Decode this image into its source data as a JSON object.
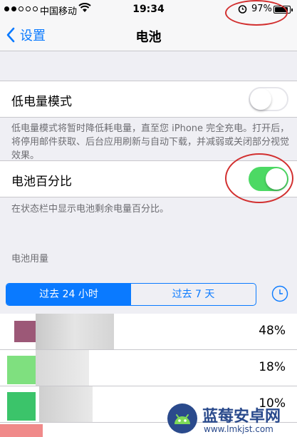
{
  "status_bar": {
    "carrier": "中国移动",
    "time": "19:34",
    "battery": "97%",
    "battery_level": 0.97
  },
  "nav": {
    "back_label": "设置",
    "title": "电池"
  },
  "low_power": {
    "label": "低电量模式",
    "enabled": false,
    "footnote": "低电量模式将暂时降低耗电量，直至您 iPhone 完全充电。打开后，将停用邮件获取、后台应用刷新与自动下载，并减弱或关闭部分视觉效果。"
  },
  "battery_percentage": {
    "label": "电池百分比",
    "enabled": true,
    "footnote": "在状态栏中显示电池剩余电量百分比。"
  },
  "usage_section": {
    "header": "电池用量",
    "tabs": [
      {
        "label": "过去 24 小时",
        "active": true
      },
      {
        "label": "过去 7 天",
        "active": false
      }
    ],
    "rows": [
      {
        "percent": "48%"
      },
      {
        "percent": "18%"
      },
      {
        "percent": "10%"
      }
    ]
  },
  "watermark": {
    "name": "蓝莓安卓网",
    "url": "www.lmkjst.com"
  },
  "colors": {
    "accent": "#0a7aff",
    "switch_on": "#4cd964",
    "annotation": "#d23030"
  }
}
